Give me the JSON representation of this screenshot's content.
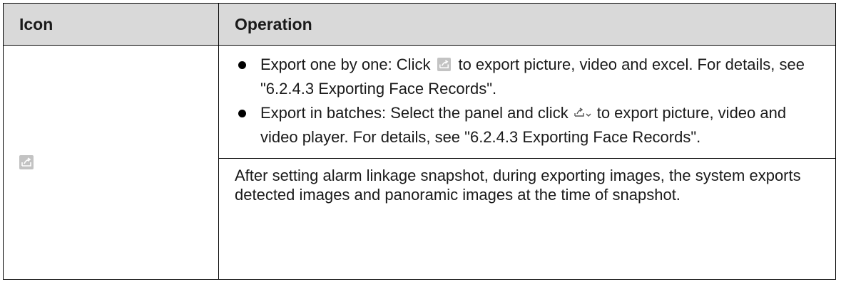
{
  "table": {
    "header": {
      "icon": "Icon",
      "operation": "Operation"
    },
    "row": {
      "icon_name": "export-icon",
      "bullets": [
        {
          "text_before": "Export one by one: Click",
          "icon_name": "export-icon",
          "text_after": "to export picture, video and excel. For details, see \"6.2.4.3 Exporting Face Records\"."
        },
        {
          "text_before": "Export in batches: Select the panel and click",
          "icon_name": "export-dropdown-icon",
          "text_after": "to export picture, video and video player. For details, see \"6.2.4.3 Exporting Face Records\"."
        }
      ],
      "note": "After setting alarm linkage snapshot, during exporting images, the system exports detected images and panoramic images at the time of snapshot."
    }
  }
}
